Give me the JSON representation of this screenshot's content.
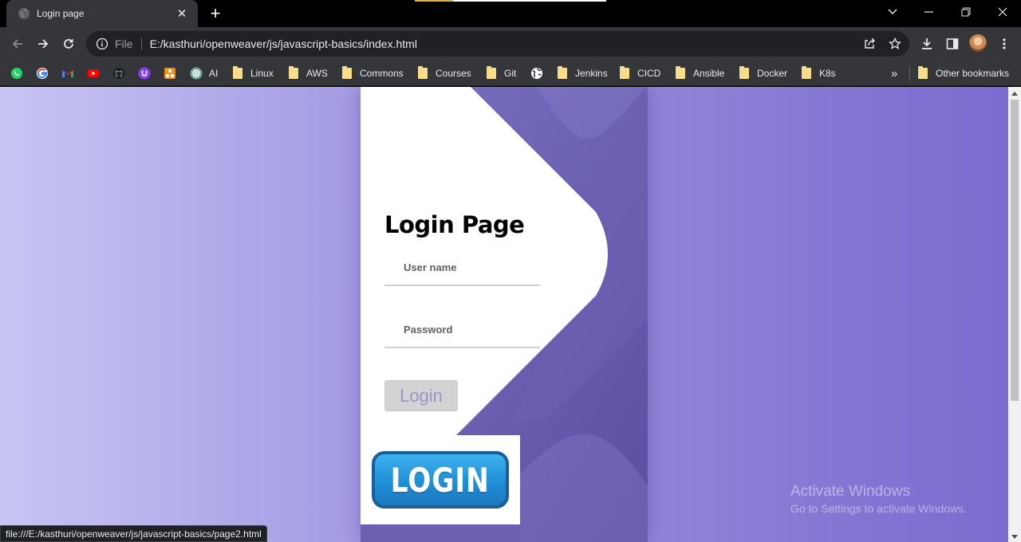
{
  "browser": {
    "tab_title": "Login page",
    "omnibox": {
      "scheme": "File",
      "url": "E:/kasthuri/openweaver/js/javascript-basics/index.html"
    },
    "bookmarks": [
      {
        "label": "",
        "icon": "whatsapp-icon"
      },
      {
        "label": "",
        "icon": "google-icon"
      },
      {
        "label": "",
        "icon": "gmail-icon"
      },
      {
        "label": "",
        "icon": "youtube-icon"
      },
      {
        "label": "",
        "icon": "github-icon"
      },
      {
        "label": "",
        "icon": "u-icon"
      },
      {
        "label": "",
        "icon": "orange-icon"
      },
      {
        "label": "AI",
        "icon": "chatgpt-icon"
      },
      {
        "label": "Linux",
        "icon": "folder-icon"
      },
      {
        "label": "AWS",
        "icon": "folder-icon"
      },
      {
        "label": "Commons",
        "icon": "folder-icon"
      },
      {
        "label": "Courses",
        "icon": "folder-icon"
      },
      {
        "label": "Git",
        "icon": "folder-icon"
      },
      {
        "label": "",
        "icon": "globe-icon"
      },
      {
        "label": "Jenkins",
        "icon": "folder-icon"
      },
      {
        "label": "CICD",
        "icon": "folder-icon"
      },
      {
        "label": "Ansible",
        "icon": "folder-icon"
      },
      {
        "label": "Docker",
        "icon": "folder-icon"
      },
      {
        "label": "K8s",
        "icon": "folder-icon"
      }
    ],
    "overflow_label": "»",
    "other_bookmarks": "Other bookmarks",
    "status_url": "file:///E:/kasthuri/openweaver/js/javascript-basics/page2.html"
  },
  "page": {
    "title": "Login Page",
    "username_placeholder": "User name",
    "password_placeholder": "Password",
    "login_button": "Login",
    "login_image_text": "LOGIN"
  },
  "watermark": {
    "line1": "Activate Windows",
    "line2": "Go to Settings to activate Windows."
  },
  "colors": {
    "card_accent": "#6f64b4",
    "page_gradient_start": "#c8c5f4",
    "page_gradient_end": "#7a6bcf",
    "login_image_blue": "#1f8fd6"
  }
}
